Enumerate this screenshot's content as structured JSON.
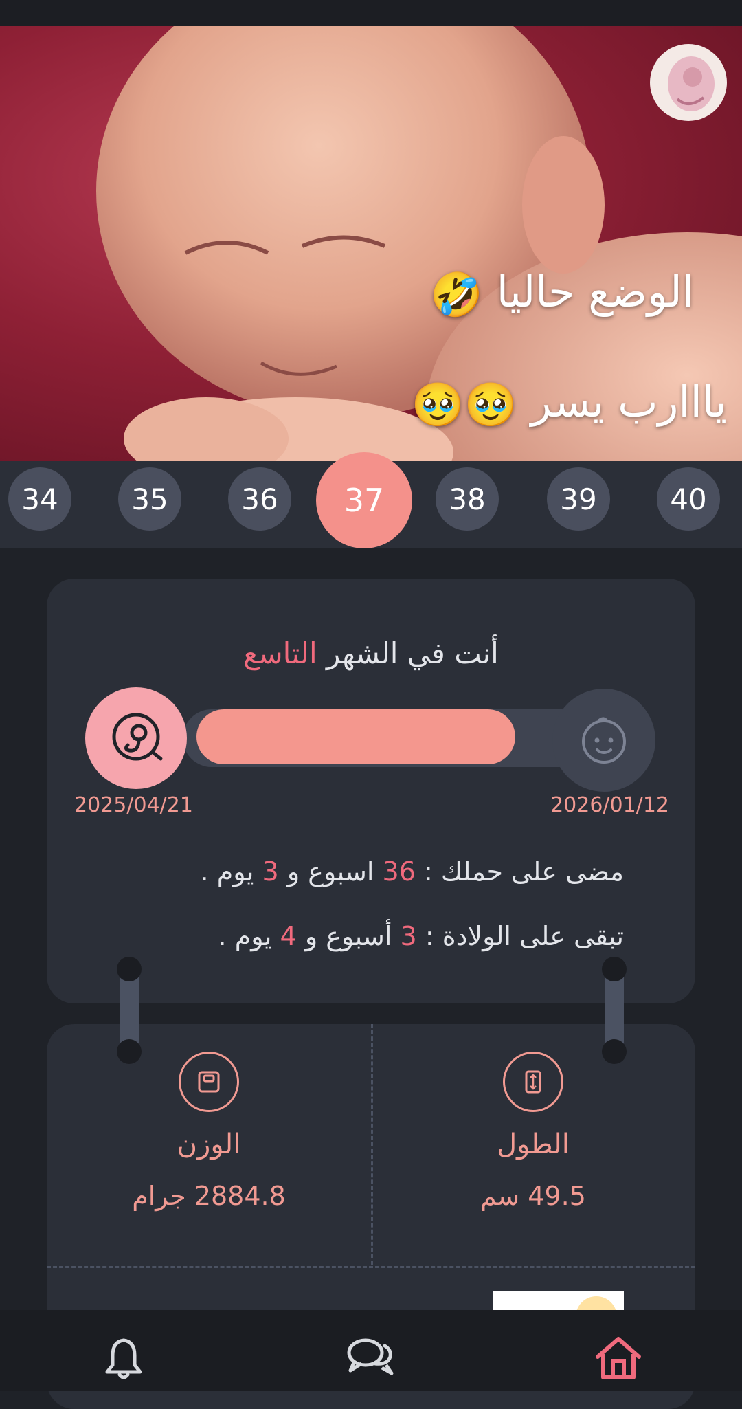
{
  "hero": {
    "line1": "الوضع حاليا",
    "line1_emoji": "🤣",
    "line2": "يااارب يسر",
    "line2_emoji": "🥹🥹"
  },
  "weeks": [
    "34",
    "35",
    "36",
    "37",
    "38",
    "39",
    "40"
  ],
  "selected_week": "37",
  "progress": {
    "title_prefix": "أنت في الشهر",
    "title_month": "التاسع",
    "start_date": "2025/04/21",
    "end_date": "2026/01/12",
    "progress_fraction": 0.9,
    "elapsed_prefix": "مضى على حملك :",
    "elapsed_weeks": "36",
    "elapsed_mid": "اسبوع و",
    "elapsed_days": "3",
    "elapsed_suffix": "يوم .",
    "remaining_prefix": "تبقى على الولادة :",
    "remaining_weeks": "3",
    "remaining_mid": "أسبوع و",
    "remaining_days": "4",
    "remaining_suffix": "يوم ."
  },
  "stats": {
    "weight_label": "الوزن",
    "weight_value": "2884.8 جرام",
    "length_label": "الطول",
    "length_value": "49.5 سم"
  },
  "nav": {
    "icons": [
      "bell-icon",
      "chat-icon",
      "home-icon"
    ],
    "active": "home-icon"
  },
  "colors": {
    "accent": "#f06a7d",
    "progress_fill": "#f4978e",
    "card_bg": "#2b2f38",
    "week_inactive": "#4a4f5e",
    "week_active": "#f4918b"
  }
}
